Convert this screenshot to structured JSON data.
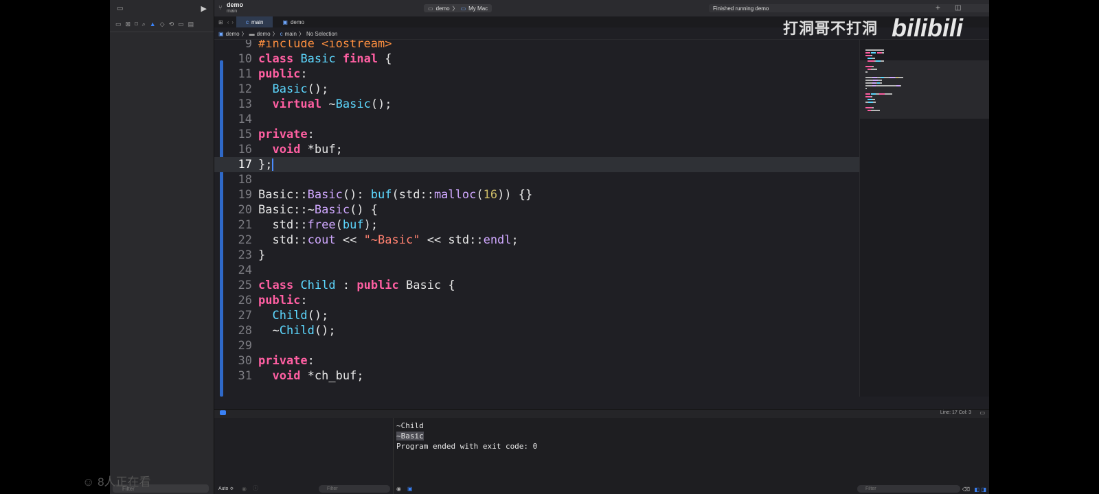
{
  "sidebar": {
    "filter_placeholder": "Filter"
  },
  "titlebar": {
    "project_name": "demo",
    "branch": "main",
    "scheme": "demo",
    "destination": "My Mac",
    "status": "Finished running demo"
  },
  "tabs": [
    {
      "label": "main"
    },
    {
      "label": "demo"
    }
  ],
  "jumpbar": {
    "items": [
      "demo",
      "demo",
      "main",
      "No Selection"
    ]
  },
  "editor": {
    "lines": [
      {
        "n": "9",
        "tokens": [
          {
            "t": "#include <iostream>",
            "c": "hash"
          }
        ]
      },
      {
        "n": "10",
        "tokens": [
          {
            "t": "class",
            "c": "kw"
          },
          {
            "t": " "
          },
          {
            "t": "Basic",
            "c": "ty"
          },
          {
            "t": " "
          },
          {
            "t": "final",
            "c": "kw"
          },
          {
            "t": " {"
          }
        ]
      },
      {
        "n": "11",
        "tokens": [
          {
            "t": "public",
            "c": "kw"
          },
          {
            "t": ":"
          }
        ]
      },
      {
        "n": "12",
        "tokens": [
          {
            "t": "  "
          },
          {
            "t": "Basic",
            "c": "ty"
          },
          {
            "t": "();"
          }
        ]
      },
      {
        "n": "13",
        "tokens": [
          {
            "t": "  "
          },
          {
            "t": "virtual",
            "c": "kw"
          },
          {
            "t": " ~"
          },
          {
            "t": "Basic",
            "c": "ty"
          },
          {
            "t": "();"
          }
        ]
      },
      {
        "n": "14",
        "tokens": []
      },
      {
        "n": "15",
        "tokens": [
          {
            "t": "private",
            "c": "kw"
          },
          {
            "t": ":"
          }
        ]
      },
      {
        "n": "16",
        "tokens": [
          {
            "t": "  "
          },
          {
            "t": "void",
            "c": "kw"
          },
          {
            "t": " *buf;"
          }
        ]
      },
      {
        "n": "17",
        "tokens": [
          {
            "t": "};"
          }
        ],
        "current": true
      },
      {
        "n": "18",
        "tokens": []
      },
      {
        "n": "19",
        "tokens": [
          {
            "t": "Basic::"
          },
          {
            "t": "Basic",
            "c": "ty2"
          },
          {
            "t": "(): "
          },
          {
            "t": "buf",
            "c": "ty"
          },
          {
            "t": "(std::"
          },
          {
            "t": "malloc",
            "c": "ty2"
          },
          {
            "t": "("
          },
          {
            "t": "16",
            "c": "num"
          },
          {
            "t": ")) {}"
          }
        ]
      },
      {
        "n": "20",
        "tokens": [
          {
            "t": "Basic::~"
          },
          {
            "t": "Basic",
            "c": "ty2"
          },
          {
            "t": "() {"
          }
        ]
      },
      {
        "n": "21",
        "tokens": [
          {
            "t": "  std::"
          },
          {
            "t": "free",
            "c": "ty2"
          },
          {
            "t": "("
          },
          {
            "t": "buf",
            "c": "ty"
          },
          {
            "t": ");"
          }
        ]
      },
      {
        "n": "22",
        "tokens": [
          {
            "t": "  std::"
          },
          {
            "t": "cout",
            "c": "ty2"
          },
          {
            "t": " << "
          },
          {
            "t": "\"~Basic\"",
            "c": "str"
          },
          {
            "t": " << std::"
          },
          {
            "t": "endl",
            "c": "ty2"
          },
          {
            "t": ";"
          }
        ]
      },
      {
        "n": "23",
        "tokens": [
          {
            "t": "}"
          }
        ]
      },
      {
        "n": "24",
        "tokens": []
      },
      {
        "n": "25",
        "tokens": [
          {
            "t": "class",
            "c": "kw"
          },
          {
            "t": " "
          },
          {
            "t": "Child",
            "c": "ty"
          },
          {
            "t": " : "
          },
          {
            "t": "public",
            "c": "kw"
          },
          {
            "t": " Basic {"
          }
        ]
      },
      {
        "n": "26",
        "tokens": [
          {
            "t": "public",
            "c": "kw"
          },
          {
            "t": ":"
          }
        ]
      },
      {
        "n": "27",
        "tokens": [
          {
            "t": "  "
          },
          {
            "t": "Child",
            "c": "ty"
          },
          {
            "t": "();"
          }
        ]
      },
      {
        "n": "28",
        "tokens": [
          {
            "t": "  ~"
          },
          {
            "t": "Child",
            "c": "ty"
          },
          {
            "t": "();"
          }
        ]
      },
      {
        "n": "29",
        "tokens": []
      },
      {
        "n": "30",
        "tokens": [
          {
            "t": "private",
            "c": "kw"
          },
          {
            "t": ":"
          }
        ]
      },
      {
        "n": "31",
        "tokens": [
          {
            "t": "  "
          },
          {
            "t": "void",
            "c": "kw"
          },
          {
            "t": " *ch_buf;"
          }
        ]
      }
    ]
  },
  "cursor_position": "Line: 17  Col: 3",
  "watermark": {
    "channel": "打洞哥不打洞",
    "logo": "bilibili"
  },
  "debug": {
    "variables_mode": "Auto ≎",
    "variables_filter_placeholder": "Filter",
    "console_filter_placeholder": "Filter",
    "console_lines": [
      "~Child",
      "~Basic",
      "Program ended with exit code: 0"
    ]
  },
  "viewers": "8人正在看",
  "colors": {
    "keyword": "#ff5fa2",
    "type": "#5dd8ff",
    "function": "#d0a8ff",
    "number": "#d0bf69",
    "string": "#ff8170",
    "accent": "#3a82f7"
  }
}
